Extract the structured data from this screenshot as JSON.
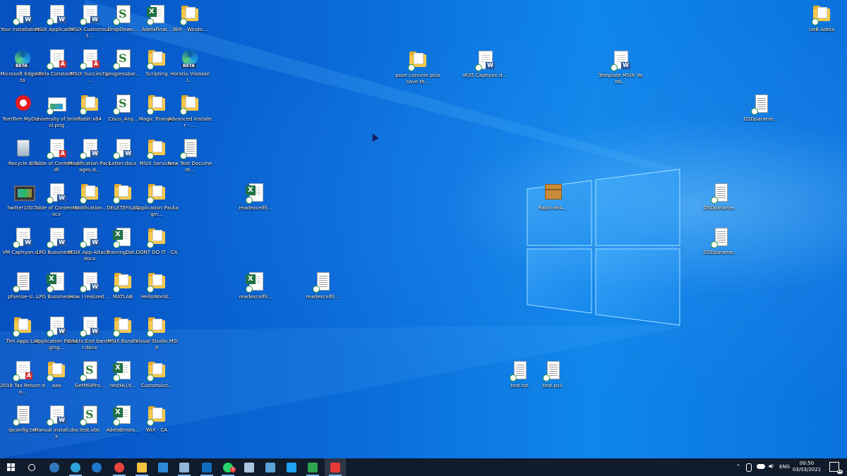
{
  "desktop_icons": [
    {
      "label": "Your installation...",
      "type": "doc-w"
    },
    {
      "label": "MSIX Applicatio...",
      "type": "doc-w"
    },
    {
      "label": "MSIX Customisat...",
      "type": "doc-w"
    },
    {
      "label": "DropDown...",
      "type": "script"
    },
    {
      "label": "AdelaFinal...",
      "type": "xls"
    },
    {
      "label": "WiX - Windo...",
      "type": "folder"
    },
    {
      "label": "Microsoft Edge Beta",
      "type": "edge"
    },
    {
      "label": "Adela Constant...",
      "type": "doc-p"
    },
    {
      "label": "MSIX Succinctly ...",
      "type": "doc-p"
    },
    {
      "label": "progressbar...",
      "type": "script"
    },
    {
      "label": "Scripting",
      "type": "folder"
    },
    {
      "label": "Horatiu Vladasel...",
      "type": "edge"
    },
    {
      "label": "TomTom MyDri...",
      "type": "tomtom"
    },
    {
      "label": "university of bristol.png",
      "type": "img"
    },
    {
      "label": "RabIt-x64",
      "type": "folder"
    },
    {
      "label": "Cisco_Any...",
      "type": "script"
    },
    {
      "label": "Magic Triangle",
      "type": "folder"
    },
    {
      "label": "Advanced Installer - ...",
      "type": "folder"
    },
    {
      "label": "Recycle Bin",
      "type": "recycle"
    },
    {
      "label": "Table of Content.pdf",
      "type": "doc-p"
    },
    {
      "label": "Modification Packages.d...",
      "type": "doc-w"
    },
    {
      "label": "Letter.docx",
      "type": "doc-w"
    },
    {
      "label": "MSIX Services",
      "type": "folder"
    },
    {
      "label": "New Text Document...",
      "type": "txt"
    },
    {
      "label": "twitter100...",
      "type": "vid"
    },
    {
      "label": "Table of Content.docx",
      "type": "doc-w"
    },
    {
      "label": "Modification...",
      "type": "folder"
    },
    {
      "label": "DELETEFILES",
      "type": "folder"
    },
    {
      "label": "Application Packagin...",
      "type": "folder"
    },
    {
      "label": "VM Caphyon.d...",
      "type": "doc-w"
    },
    {
      "label": "LPG Bussiness...",
      "type": "doc-w"
    },
    {
      "label": "MSIX App Attach.docx",
      "type": "doc-w"
    },
    {
      "label": "TrainingDat...",
      "type": "xls"
    },
    {
      "label": "DONT DO IT - CA",
      "type": "folder"
    },
    {
      "label": "pfsense-U...",
      "type": "txt"
    },
    {
      "label": "LPG Bussiness...",
      "type": "xls"
    },
    {
      "label": "How I realized ...",
      "type": "doc-w"
    },
    {
      "label": "MATLAB",
      "type": "folder"
    },
    {
      "label": "HelloWorld...",
      "type": "folder"
    },
    {
      "label": "Tim Apps List",
      "type": "folder"
    },
    {
      "label": "Application Packaging...",
      "type": "doc-w"
    },
    {
      "label": "End to End banner.docx",
      "type": "doc-w"
    },
    {
      "label": "MSIX Bundle",
      "type": "folder"
    },
    {
      "label": "Visual Studio MSIX",
      "type": "folder"
    },
    {
      "label": "2018 Tax Return do...",
      "type": "doc-p"
    },
    {
      "label": "aaa",
      "type": "folder"
    },
    {
      "label": "GetMSIPro...",
      "type": "script"
    },
    {
      "label": "testHL(V...",
      "type": "xls"
    },
    {
      "label": "CustomAct...",
      "type": "folder"
    },
    {
      "label": "ipconfig.txt",
      "type": "txt"
    },
    {
      "label": "Manual install.docx",
      "type": "doc-w"
    },
    {
      "label": "test.vbs",
      "type": "script"
    },
    {
      "label": "AdelaErrors...",
      "type": "xls"
    },
    {
      "label": "WiX - CA",
      "type": "folder"
    },
    {
      "label": "readexcelfil...",
      "type": "xls"
    },
    {
      "label": "readexcelfil...",
      "type": "xls"
    },
    {
      "label": "readexcelfil...",
      "type": "txt"
    },
    {
      "label": "poze cununie plus save th...",
      "type": "folder"
    },
    {
      "label": "IR35 Caphyon.d...",
      "type": "doc-w"
    },
    {
      "label": "Template MSIX Vend...",
      "type": "doc-w"
    },
    {
      "label": "RabIt-x64...",
      "type": "box"
    },
    {
      "label": "test.txt",
      "type": "txt"
    },
    {
      "label": "test.ps1",
      "type": "txt"
    },
    {
      "label": "UoB Adela",
      "type": "folder"
    },
    {
      "label": "DSDparame...",
      "type": "txt"
    },
    {
      "label": "DSDparame...",
      "type": "txt"
    },
    {
      "label": "DSDparame...",
      "type": "txt"
    }
  ],
  "taskbar": {
    "apps": [
      {
        "name": "start-button",
        "icon": "windows-logo",
        "color": "#ffffff"
      },
      {
        "name": "search-button",
        "icon": "circle",
        "color": "#ffffff"
      },
      {
        "name": "edge-legacy",
        "icon": "edge",
        "color": "#3277bc"
      },
      {
        "name": "edge-beta",
        "icon": "edge-beta",
        "color": "#2fa3d8"
      },
      {
        "name": "edge-dev",
        "icon": "edge-dev",
        "color": "#1f79c8"
      },
      {
        "name": "chrome",
        "icon": "chrome",
        "color": "#e8453c"
      },
      {
        "name": "file-explorer",
        "icon": "folder",
        "color": "#f3c33f"
      },
      {
        "name": "store",
        "icon": "store",
        "color": "#2b88d8"
      },
      {
        "name": "remote-desktop",
        "icon": "rdp",
        "color": "#8fb6d6"
      },
      {
        "name": "outlook",
        "icon": "outlook",
        "color": "#0f6cbd"
      },
      {
        "name": "whatsapp",
        "icon": "whatsapp",
        "color": "#25d366"
      },
      {
        "name": "editor",
        "icon": "pen",
        "color": "#aac6e0"
      },
      {
        "name": "rdp-app",
        "icon": "monitor",
        "color": "#5aa2d8"
      },
      {
        "name": "twitter",
        "icon": "bird",
        "color": "#1da1f2"
      },
      {
        "name": "camtasia-green",
        "icon": "c-green",
        "color": "#2ea44f"
      },
      {
        "name": "camtasia-red",
        "icon": "c-red",
        "color": "#e53935"
      }
    ],
    "whatsapp_badge": "3",
    "tray": {
      "language": "ENG",
      "time": "00:50",
      "date": "03/03/2021",
      "notifications": "44"
    }
  },
  "colors": {
    "desktop_accent": "#0a6fd4",
    "taskbar": "#101b2c"
  }
}
